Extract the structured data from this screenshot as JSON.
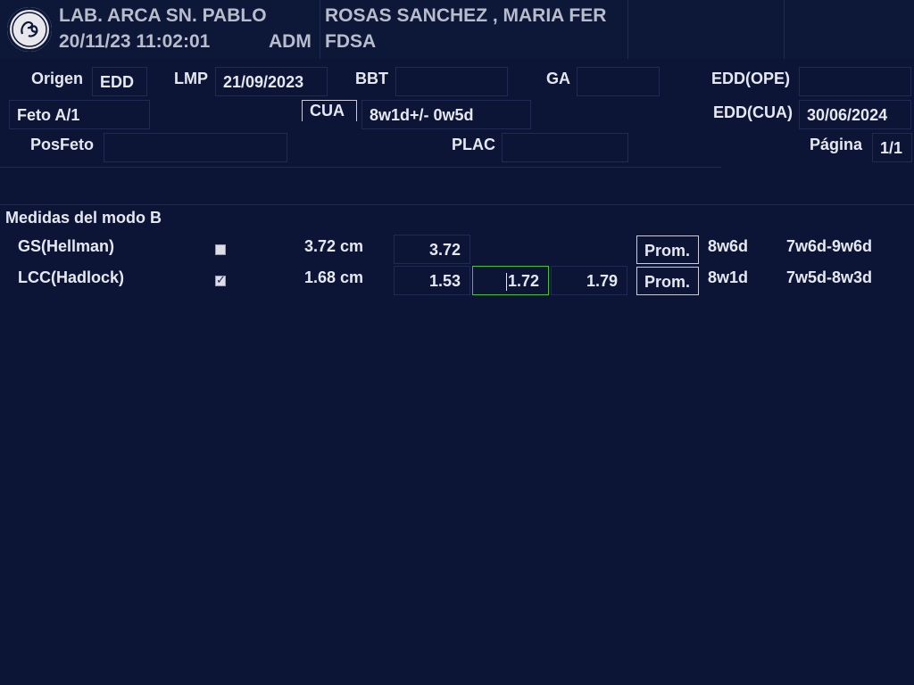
{
  "header": {
    "institution": "LAB. ARCA SN. PABLO",
    "datetime": "20/11/23 11:02:01",
    "operator": "ADM",
    "patient_name": "ROSAS SANCHEZ , MARIA FER",
    "patient_id": "FDSA",
    "logo": "GE"
  },
  "fields": {
    "origen_label": "Origen",
    "origen_value": "EDD",
    "lmp_label": "LMP",
    "lmp_value": "21/09/2023",
    "bbt_label": "BBT",
    "bbt_value": "",
    "ga_label": "GA",
    "ga_value": "",
    "edd_ope_label": "EDD(OPE)",
    "edd_ope_value": "",
    "feto_value": "Feto A/1",
    "cua_label": "CUA",
    "cua_value": "8w1d+/- 0w5d",
    "edd_cua_label": "EDD(CUA)",
    "edd_cua_value": "30/06/2024",
    "posfeto_label": "PosFeto",
    "posfeto_value": "",
    "plac_label": "PLAC",
    "plac_value": "",
    "pagina_label": "Página",
    "pagina_value": "1/1"
  },
  "section": {
    "title": "Medidas del modo B"
  },
  "measurements": [
    {
      "name": "GS(Hellman)",
      "checked": false,
      "value": "3.72 cm",
      "m1": "3.72",
      "m2": "",
      "m3": "",
      "method": "Prom.",
      "ga": "8w6d",
      "range": "7w6d-9w6d"
    },
    {
      "name": "LCC(Hadlock)",
      "checked": true,
      "value": "1.68 cm",
      "m1": "1.53",
      "m2": "1.72",
      "m3": "1.79",
      "method": "Prom.",
      "ga": "8w1d",
      "range": "7w5d-8w3d"
    }
  ],
  "colors": {
    "background": "#0c1536",
    "active_field_border": "#49c23a"
  }
}
